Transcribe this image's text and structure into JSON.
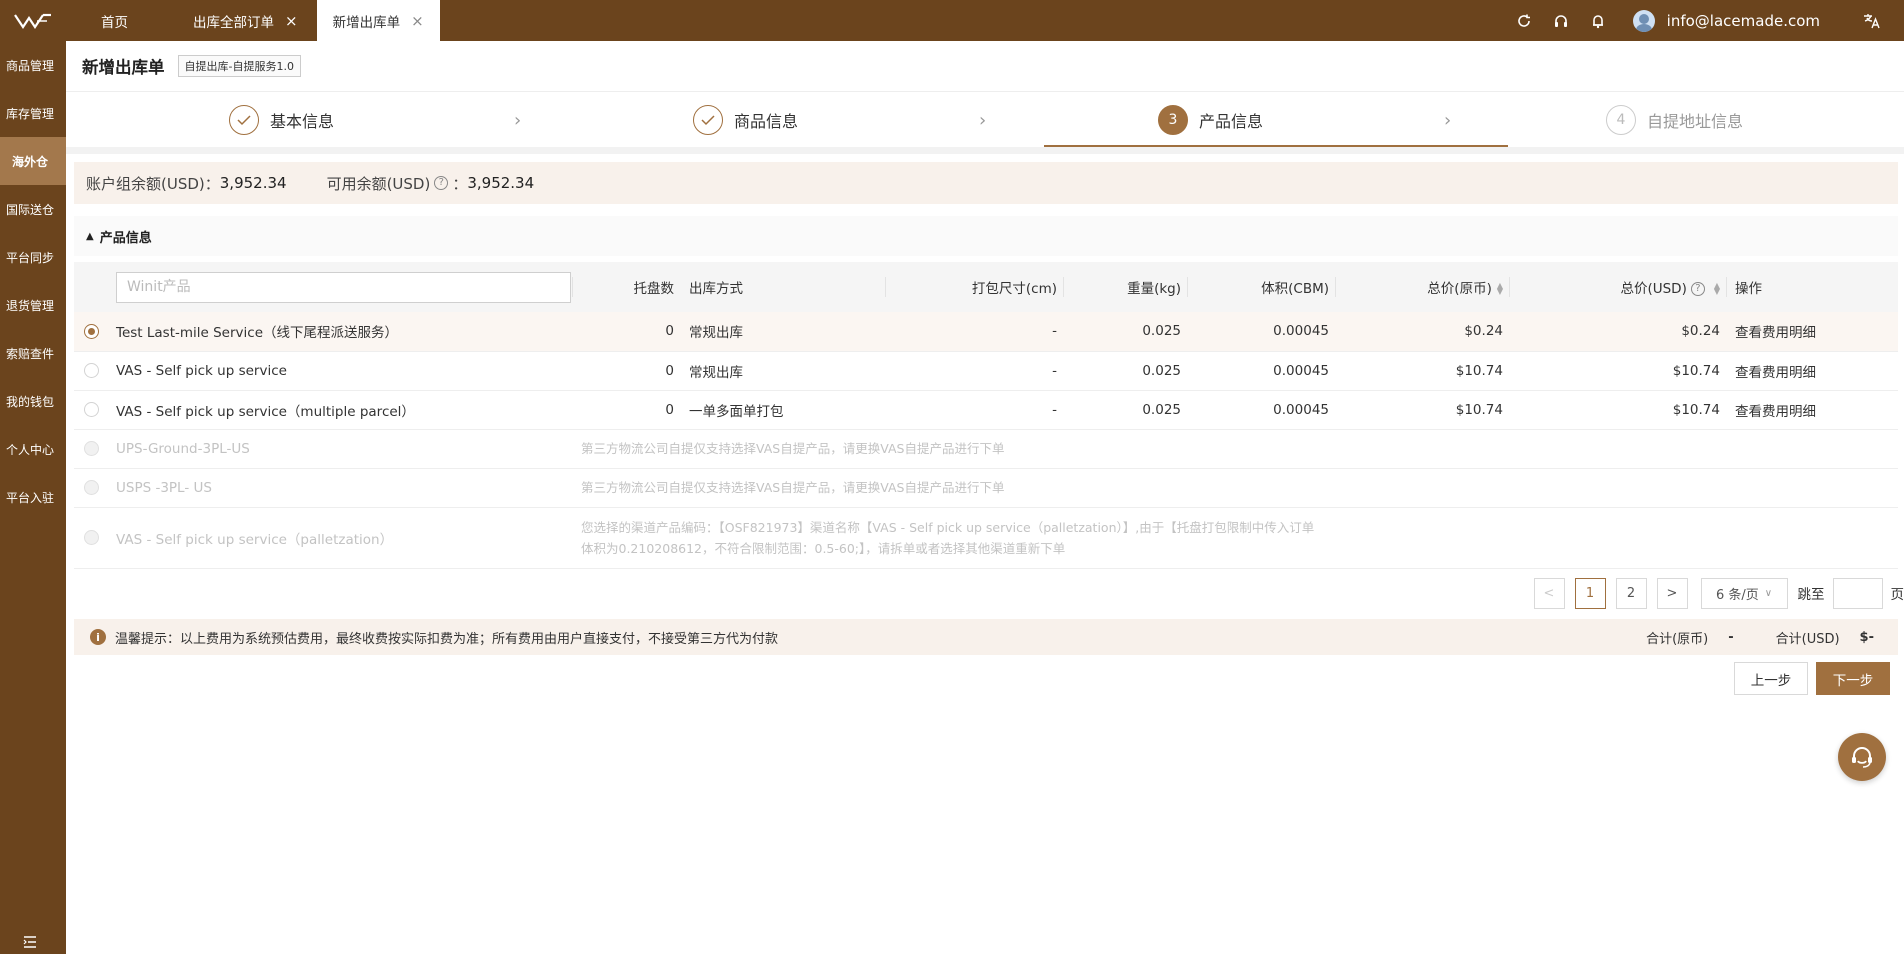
{
  "topbar": {
    "tabs": [
      {
        "label": "首页"
      },
      {
        "label": "出库全部订单"
      },
      {
        "label": "新增出库单"
      }
    ],
    "user_email": "info@lacemade.com",
    "icons": [
      "refresh-icon",
      "headset-icon",
      "bell-icon",
      "translate-icon"
    ]
  },
  "sidebar": {
    "items": [
      {
        "label": "商品管理"
      },
      {
        "label": "库存管理"
      },
      {
        "label": "海外仓"
      },
      {
        "label": "国际送仓"
      },
      {
        "label": "平台同步"
      },
      {
        "label": "退货管理"
      },
      {
        "label": "索赔查件"
      },
      {
        "label": "我的钱包"
      },
      {
        "label": "个人中心"
      },
      {
        "label": "平台入驻"
      }
    ],
    "active_index": 2
  },
  "header": {
    "title": "新增出库单",
    "tag": "自提出库-自提服务1.0"
  },
  "steps": [
    {
      "label": "基本信息",
      "state": "done",
      "number": "✓"
    },
    {
      "label": "商品信息",
      "state": "done",
      "number": "✓"
    },
    {
      "label": "产品信息",
      "state": "current",
      "number": "3"
    },
    {
      "label": "自提地址信息",
      "state": "pending",
      "number": "4"
    }
  ],
  "balance": {
    "account_label": "账户组余额(USD)：",
    "account_value": "3,952.34",
    "available_label": "可用余额(USD)",
    "available_sep": "：",
    "available_value": "3,952.34"
  },
  "section": {
    "title": "产品信息"
  },
  "table": {
    "search_placeholder": "Winit产品",
    "headers": {
      "pallets": "托盘数",
      "method": "出库方式",
      "size": "打包尺寸(cm)",
      "weight": "重量(kg)",
      "volume": "体积(CBM)",
      "total_orig": "总价(原币)",
      "total_usd": "总价(USD)",
      "action": "操作"
    },
    "rows": [
      {
        "name": "Test Last-mile Service（线下尾程派送服务）",
        "pallets": "0",
        "method": "常规出库",
        "size": "-",
        "weight": "0.025",
        "volume": "0.00045",
        "total_orig": "$0.24",
        "total_usd": "$0.24",
        "action": "查看费用明细"
      },
      {
        "name": "VAS - Self pick up service",
        "pallets": "0",
        "method": "常规出库",
        "size": "-",
        "weight": "0.025",
        "volume": "0.00045",
        "total_orig": "$10.74",
        "total_usd": "$10.74",
        "action": "查看费用明细"
      },
      {
        "name": "VAS - Self pick up service（multiple parcel）",
        "pallets": "0",
        "method": "一单多面单打包",
        "size": "-",
        "weight": "0.025",
        "volume": "0.00045",
        "total_orig": "$10.74",
        "total_usd": "$10.74",
        "action": "查看费用明细"
      }
    ],
    "disabled_rows": [
      {
        "name": "UPS-Ground-3PL-US",
        "message": "第三方物流公司自提仅支持选择VAS自提产品，请更换VAS自提产品进行下单"
      },
      {
        "name": "USPS -3PL- US",
        "message": "第三方物流公司自提仅支持选择VAS自提产品，请更换VAS自提产品进行下单"
      },
      {
        "name": "VAS - Self pick up service（palletzation）",
        "message_line1": "您选择的渠道产品编码：【OSF821973】渠道名称【VAS - Self pick up service（palletzation）】,由于【托盘打包限制中传入订单",
        "message_line2": "体积为0.210208612，不符合限制范围：0.5-60;】，请拆单或者选择其他渠道重新下单"
      }
    ]
  },
  "pagination": {
    "prev": "<",
    "pages": [
      "1",
      "2"
    ],
    "next": ">",
    "page_size": "6 条/页",
    "jump_label": "跳至",
    "page_unit": "页"
  },
  "tip": {
    "text": "温馨提示：以上费用为系统预估费用，最终收费按实际扣费为准；所有费用由用户直接支付，不接受第三方代为付款",
    "total_orig_label": "合计(原币)",
    "total_orig_value": "-",
    "total_usd_label": "合计(USD)",
    "total_usd_value": "$-"
  },
  "buttons": {
    "prev": "上一步",
    "next": "下一步"
  },
  "colors": {
    "brand": "#6b441d",
    "accent": "#a0703f",
    "highlight_bg": "#f8f1eb"
  }
}
